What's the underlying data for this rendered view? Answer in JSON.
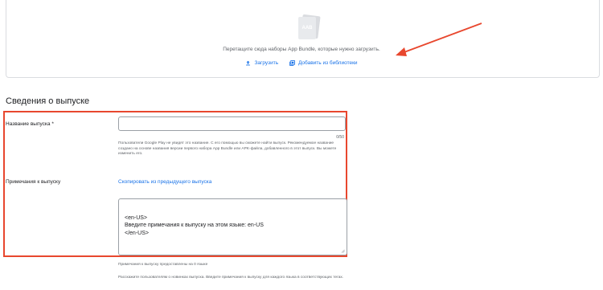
{
  "upload": {
    "icon_text": "AAB",
    "drop_text": "Перетащите сюда наборы App Bundle, которые нужно загрузить.",
    "upload_label": "Загрузить",
    "library_label": "Добавить из библиотеки"
  },
  "release": {
    "section_title": "Сведения о выпуске",
    "name_label": "Название выпуска",
    "required_mark": "*",
    "name_value": "",
    "counter": "0/50",
    "name_hint": "Пользователи Google Play не увидят это название. С его помощью вы сможете найти выпуск. Рекомендуемое название создано на основе названия версии первого набора App Bundle или APK-файла, добавленного в этот выпуск. Вы можете изменить его.",
    "notes_label": "Примечания к выпуску",
    "copy_link": "Скопировать из предыдущего выпуска",
    "notes_value": "<en-US>\nВведите примечания к выпуску на этом языке: en-US\n</en-US>",
    "notes_count_text": "Примечания к выпуску предоставлены на 0 языке",
    "notes_help_text": "Расскажите пользователям о новинках выпуска. Введите примечания к выпуску для каждого языка в соответствующих тегах."
  },
  "colors": {
    "highlight": "#e8472e",
    "link": "#1a73e8",
    "arrow": "#e8472e"
  }
}
